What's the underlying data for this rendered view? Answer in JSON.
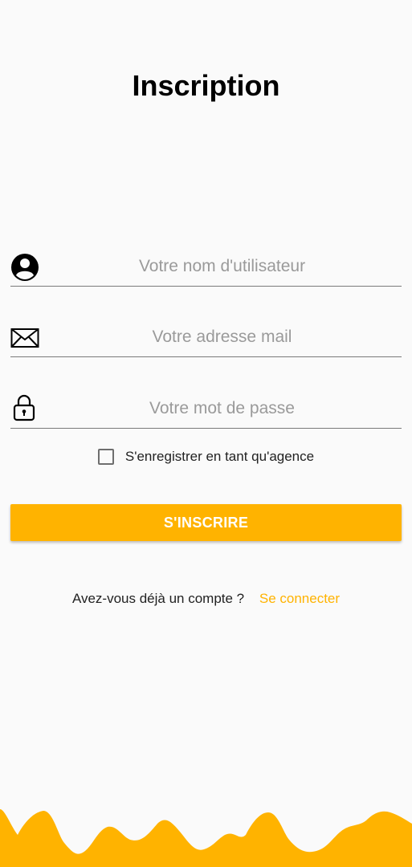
{
  "page": {
    "title": "Inscription"
  },
  "form": {
    "username": {
      "icon": "account-circle-icon",
      "value": "",
      "placeholder": "Votre nom d'utilisateur"
    },
    "email": {
      "icon": "envelope-icon",
      "value": "",
      "placeholder": "Votre adresse mail"
    },
    "password": {
      "icon": "lock-icon",
      "value": "",
      "placeholder": "Votre mot de passe"
    },
    "agency_checkbox": {
      "label": "S'enregistrer en tant qu'agence",
      "checked": false
    },
    "submit_label": "S'INSCRIRE"
  },
  "login": {
    "question": "Avez-vous déjà un compte ?",
    "link_label": "Se connecter"
  },
  "colors": {
    "accent": "#ffb300",
    "background": "#fafafa",
    "placeholder": "#9a9a9a",
    "underline": "#7a7a7a"
  }
}
